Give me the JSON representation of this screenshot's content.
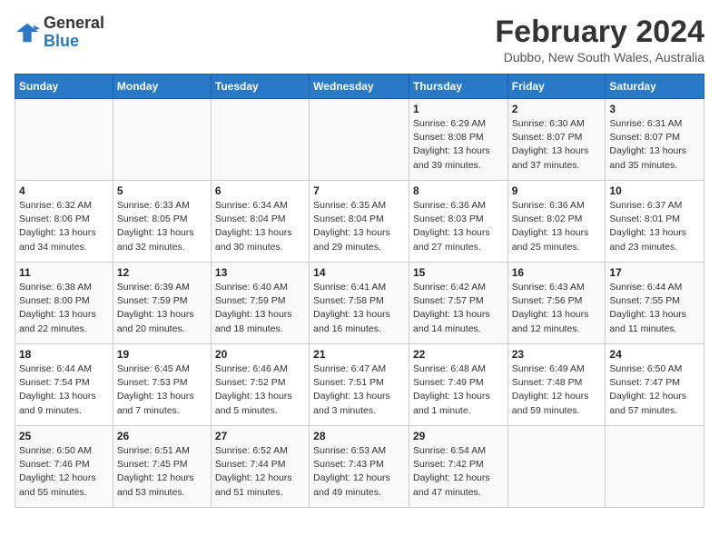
{
  "header": {
    "logo_line1": "General",
    "logo_line2": "Blue",
    "month": "February 2024",
    "location": "Dubbo, New South Wales, Australia"
  },
  "weekdays": [
    "Sunday",
    "Monday",
    "Tuesday",
    "Wednesday",
    "Thursday",
    "Friday",
    "Saturday"
  ],
  "weeks": [
    [
      {
        "day": "",
        "sunrise": "",
        "sunset": "",
        "daylight": ""
      },
      {
        "day": "",
        "sunrise": "",
        "sunset": "",
        "daylight": ""
      },
      {
        "day": "",
        "sunrise": "",
        "sunset": "",
        "daylight": ""
      },
      {
        "day": "",
        "sunrise": "",
        "sunset": "",
        "daylight": ""
      },
      {
        "day": "1",
        "sunrise": "Sunrise: 6:29 AM",
        "sunset": "Sunset: 8:08 PM",
        "daylight": "Daylight: 13 hours and 39 minutes."
      },
      {
        "day": "2",
        "sunrise": "Sunrise: 6:30 AM",
        "sunset": "Sunset: 8:07 PM",
        "daylight": "Daylight: 13 hours and 37 minutes."
      },
      {
        "day": "3",
        "sunrise": "Sunrise: 6:31 AM",
        "sunset": "Sunset: 8:07 PM",
        "daylight": "Daylight: 13 hours and 35 minutes."
      }
    ],
    [
      {
        "day": "4",
        "sunrise": "Sunrise: 6:32 AM",
        "sunset": "Sunset: 8:06 PM",
        "daylight": "Daylight: 13 hours and 34 minutes."
      },
      {
        "day": "5",
        "sunrise": "Sunrise: 6:33 AM",
        "sunset": "Sunset: 8:05 PM",
        "daylight": "Daylight: 13 hours and 32 minutes."
      },
      {
        "day": "6",
        "sunrise": "Sunrise: 6:34 AM",
        "sunset": "Sunset: 8:04 PM",
        "daylight": "Daylight: 13 hours and 30 minutes."
      },
      {
        "day": "7",
        "sunrise": "Sunrise: 6:35 AM",
        "sunset": "Sunset: 8:04 PM",
        "daylight": "Daylight: 13 hours and 29 minutes."
      },
      {
        "day": "8",
        "sunrise": "Sunrise: 6:36 AM",
        "sunset": "Sunset: 8:03 PM",
        "daylight": "Daylight: 13 hours and 27 minutes."
      },
      {
        "day": "9",
        "sunrise": "Sunrise: 6:36 AM",
        "sunset": "Sunset: 8:02 PM",
        "daylight": "Daylight: 13 hours and 25 minutes."
      },
      {
        "day": "10",
        "sunrise": "Sunrise: 6:37 AM",
        "sunset": "Sunset: 8:01 PM",
        "daylight": "Daylight: 13 hours and 23 minutes."
      }
    ],
    [
      {
        "day": "11",
        "sunrise": "Sunrise: 6:38 AM",
        "sunset": "Sunset: 8:00 PM",
        "daylight": "Daylight: 13 hours and 22 minutes."
      },
      {
        "day": "12",
        "sunrise": "Sunrise: 6:39 AM",
        "sunset": "Sunset: 7:59 PM",
        "daylight": "Daylight: 13 hours and 20 minutes."
      },
      {
        "day": "13",
        "sunrise": "Sunrise: 6:40 AM",
        "sunset": "Sunset: 7:59 PM",
        "daylight": "Daylight: 13 hours and 18 minutes."
      },
      {
        "day": "14",
        "sunrise": "Sunrise: 6:41 AM",
        "sunset": "Sunset: 7:58 PM",
        "daylight": "Daylight: 13 hours and 16 minutes."
      },
      {
        "day": "15",
        "sunrise": "Sunrise: 6:42 AM",
        "sunset": "Sunset: 7:57 PM",
        "daylight": "Daylight: 13 hours and 14 minutes."
      },
      {
        "day": "16",
        "sunrise": "Sunrise: 6:43 AM",
        "sunset": "Sunset: 7:56 PM",
        "daylight": "Daylight: 13 hours and 12 minutes."
      },
      {
        "day": "17",
        "sunrise": "Sunrise: 6:44 AM",
        "sunset": "Sunset: 7:55 PM",
        "daylight": "Daylight: 13 hours and 11 minutes."
      }
    ],
    [
      {
        "day": "18",
        "sunrise": "Sunrise: 6:44 AM",
        "sunset": "Sunset: 7:54 PM",
        "daylight": "Daylight: 13 hours and 9 minutes."
      },
      {
        "day": "19",
        "sunrise": "Sunrise: 6:45 AM",
        "sunset": "Sunset: 7:53 PM",
        "daylight": "Daylight: 13 hours and 7 minutes."
      },
      {
        "day": "20",
        "sunrise": "Sunrise: 6:46 AM",
        "sunset": "Sunset: 7:52 PM",
        "daylight": "Daylight: 13 hours and 5 minutes."
      },
      {
        "day": "21",
        "sunrise": "Sunrise: 6:47 AM",
        "sunset": "Sunset: 7:51 PM",
        "daylight": "Daylight: 13 hours and 3 minutes."
      },
      {
        "day": "22",
        "sunrise": "Sunrise: 6:48 AM",
        "sunset": "Sunset: 7:49 PM",
        "daylight": "Daylight: 13 hours and 1 minute."
      },
      {
        "day": "23",
        "sunrise": "Sunrise: 6:49 AM",
        "sunset": "Sunset: 7:48 PM",
        "daylight": "Daylight: 12 hours and 59 minutes."
      },
      {
        "day": "24",
        "sunrise": "Sunrise: 6:50 AM",
        "sunset": "Sunset: 7:47 PM",
        "daylight": "Daylight: 12 hours and 57 minutes."
      }
    ],
    [
      {
        "day": "25",
        "sunrise": "Sunrise: 6:50 AM",
        "sunset": "Sunset: 7:46 PM",
        "daylight": "Daylight: 12 hours and 55 minutes."
      },
      {
        "day": "26",
        "sunrise": "Sunrise: 6:51 AM",
        "sunset": "Sunset: 7:45 PM",
        "daylight": "Daylight: 12 hours and 53 minutes."
      },
      {
        "day": "27",
        "sunrise": "Sunrise: 6:52 AM",
        "sunset": "Sunset: 7:44 PM",
        "daylight": "Daylight: 12 hours and 51 minutes."
      },
      {
        "day": "28",
        "sunrise": "Sunrise: 6:53 AM",
        "sunset": "Sunset: 7:43 PM",
        "daylight": "Daylight: 12 hours and 49 minutes."
      },
      {
        "day": "29",
        "sunrise": "Sunrise: 6:54 AM",
        "sunset": "Sunset: 7:42 PM",
        "daylight": "Daylight: 12 hours and 47 minutes."
      },
      {
        "day": "",
        "sunrise": "",
        "sunset": "",
        "daylight": ""
      },
      {
        "day": "",
        "sunrise": "",
        "sunset": "",
        "daylight": ""
      }
    ]
  ]
}
